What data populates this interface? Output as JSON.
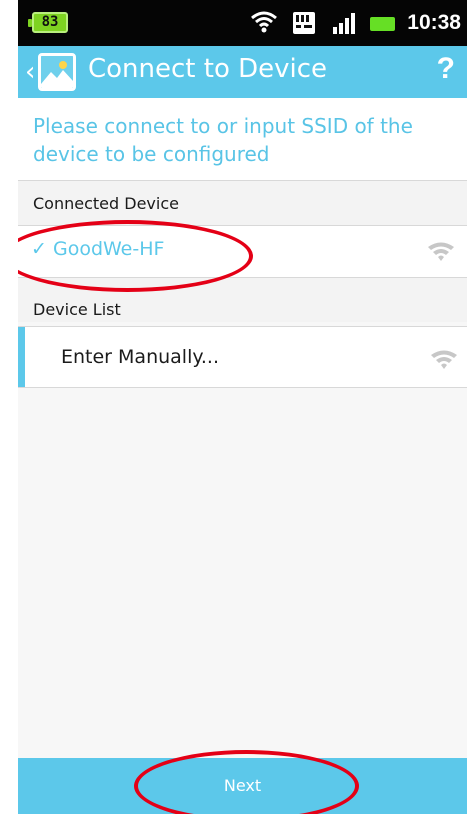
{
  "status_bar": {
    "battery_level": "83",
    "time": "10:38"
  },
  "app_bar": {
    "title": "Connect to Device",
    "help_label": "?"
  },
  "instruction": "Please connect to or input SSID of the device to be configured",
  "connected_section": {
    "label": "Connected Device",
    "device_name": "GoodWe-HF",
    "check_mark": "✓"
  },
  "device_list": {
    "label": "Device List",
    "manual_entry": "Enter Manually..."
  },
  "buttons": {
    "next": "Next"
  },
  "colors": {
    "accent": "#5cc8ea",
    "status_bar": "#050505",
    "annotation_red": "#e40016"
  }
}
